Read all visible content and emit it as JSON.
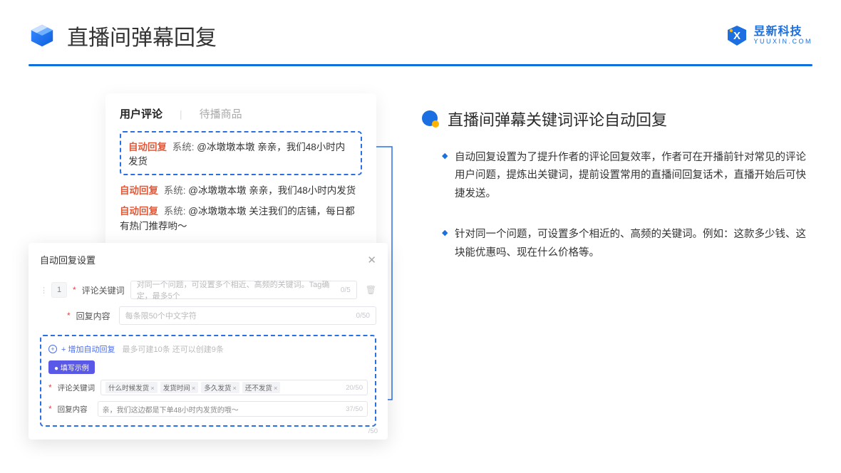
{
  "header": {
    "title": "直播间弹幕回复",
    "brand_cn": "昱新科技",
    "brand_en": "YUUXIN.COM"
  },
  "comments": {
    "tab_active": "用户评论",
    "tab_inactive": "待播商品",
    "auto_badge": "自动回复",
    "system_label": "系统:",
    "items": [
      "@冰墩墩本墩 亲亲，我们48小时内发货",
      "@冰墩墩本墩 亲亲，我们48小时内发货",
      "@冰墩墩本墩 关注我们的店铺，每日都有热门推荐哟～"
    ]
  },
  "settings": {
    "title": "自动回复设置",
    "index": "1",
    "kw_label": "评论关键词",
    "kw_placeholder": "对同一个问题，可设置多个相近、高频的关键词。Tag确定，最多5个",
    "kw_count": "0/5",
    "reply_label": "回复内容",
    "reply_placeholder": "每条限50个中文字符",
    "reply_count": "0/50",
    "add_label": "+ 增加自动回复",
    "add_hint": "最多可建10条 还可以创建9条",
    "example_pill": "● 填写示例",
    "ex_kw_label": "评论关键词",
    "ex_tags": [
      "什么时候发货",
      "发货时间",
      "多久发货",
      "还不发货"
    ],
    "ex_kw_count": "20/50",
    "ex_reply_label": "回复内容",
    "ex_reply_text": "亲，我们这边都是下单48小时内发货的哦～",
    "ex_reply_count": "37/50",
    "outside_count": "/50"
  },
  "right": {
    "section_title": "直播间弹幕关键词评论自动回复",
    "paras": [
      "自动回复设置为了提升作者的评论回复效率，作者可在开播前针对常见的评论用户问题，提炼出关键词，提前设置常用的直播间回复话术，直播开始后可快捷发送。",
      "针对同一个问题，可设置多个相近的、高频的关键词。例如：这款多少钱、这块能优惠吗、现在什么价格等。"
    ]
  }
}
